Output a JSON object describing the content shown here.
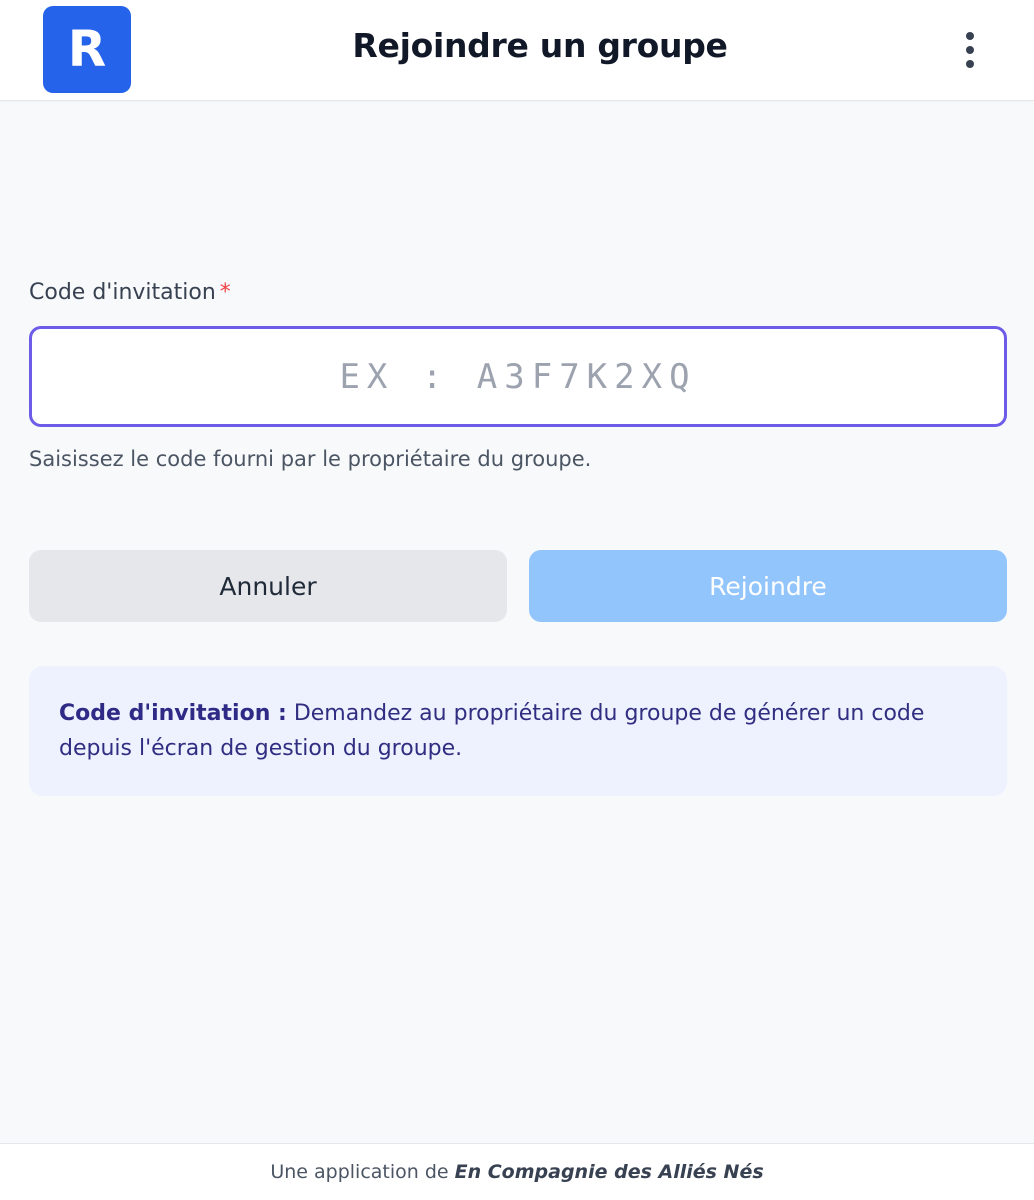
{
  "colors": {
    "brand": "#2563eb",
    "input_border": "#6c5ce7",
    "required": "#ef4444",
    "join_disabled": "#93c5fd",
    "info_bg": "#eef2ff"
  },
  "header": {
    "logo_letter": "R",
    "title": "Rejoindre un groupe",
    "menu_icon": "more-vertical-icon"
  },
  "form": {
    "label": "Code d'invitation",
    "required_mark": "*",
    "input_value": "",
    "input_placeholder": "EX : A3F7K2XQ",
    "helper": "Saisissez le code fourni par le propriétaire du groupe."
  },
  "actions": {
    "cancel_label": "Annuler",
    "join_label": "Rejoindre",
    "join_enabled": false
  },
  "info": {
    "title": "Code d'invitation :",
    "text": "Demandez au propriétaire du groupe de générer un code depuis l'écran de gestion du groupe."
  },
  "footer": {
    "prefix": "Une application de",
    "company": "En Compagnie des Alliés Nés"
  }
}
